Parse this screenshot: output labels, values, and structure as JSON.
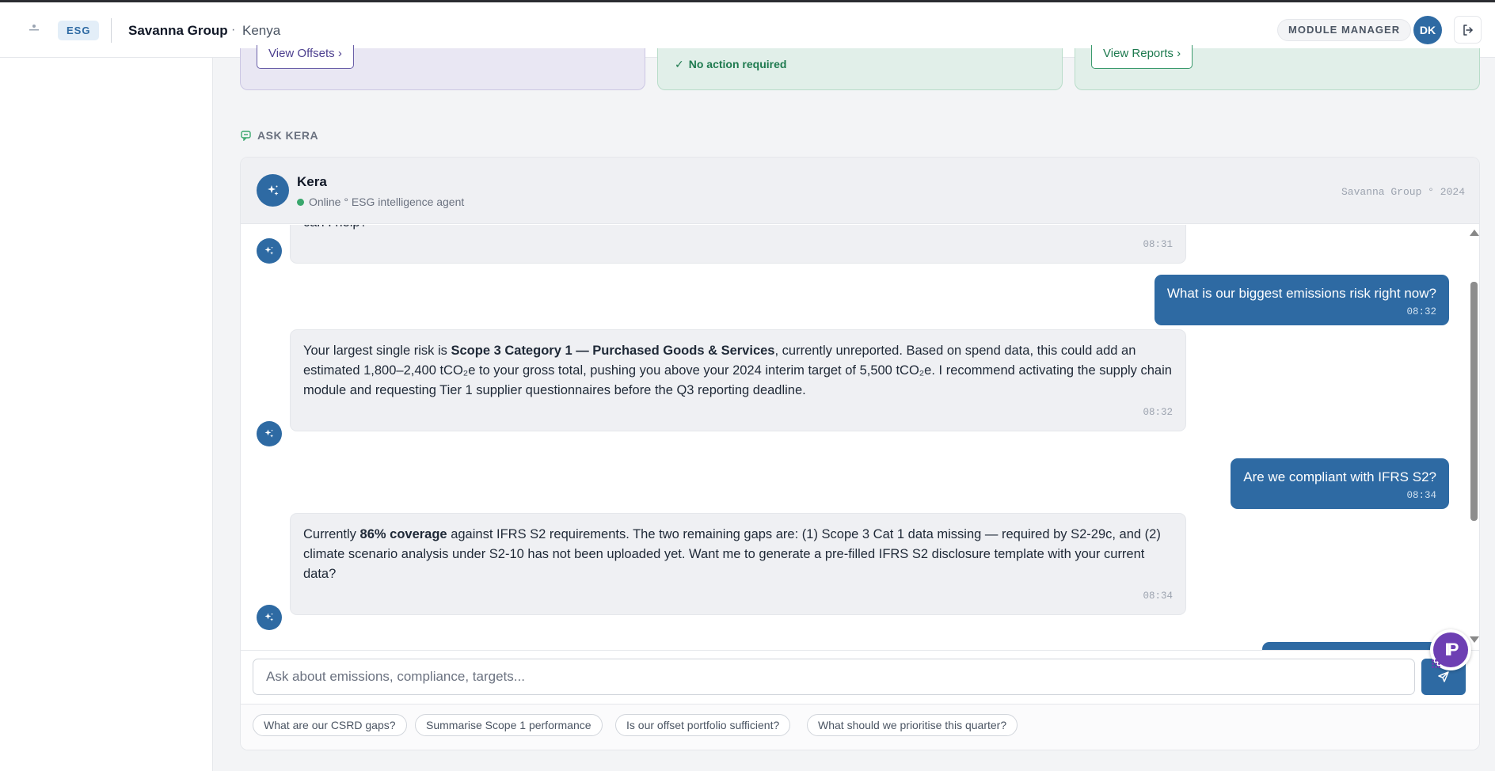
{
  "header": {
    "badge": "ESG",
    "org_name": "Savanna Group",
    "separator": "·",
    "country": "Kenya",
    "role": "MODULE MANAGER",
    "user_initials": "DK"
  },
  "cards": {
    "offsets_button": "View Offsets",
    "status_text": "No action required",
    "reports_button": "View Reports"
  },
  "section": {
    "title": "ASK KERA"
  },
  "chat": {
    "agent_name": "Kera",
    "agent_status": "Online ° ESG intelligence agent",
    "meta": "Savanna Group ° 2024",
    "messages": [
      {
        "from": "bot",
        "text": "can I help?",
        "time": "08:31"
      },
      {
        "from": "user",
        "text": "What is our biggest emissions risk right now?",
        "time": "08:32"
      },
      {
        "from": "bot",
        "pre": "Your largest single risk is ",
        "bold": "Scope 3 Category 1 — Purchased Goods & Services",
        "post": ", currently unreported. Based on spend data, this could add an estimated 1,800–2,400 tCO₂e to your gross total, pushing you above your 2024 interim target of 5,500 tCO₂e. I recommend activating the supply chain module and requesting Tier 1 supplier questionnaires before the Q3 reporting deadline.",
        "time": "08:32"
      },
      {
        "from": "user",
        "text": "Are we compliant with IFRS S2?",
        "time": "08:34"
      },
      {
        "from": "bot",
        "pre": "Currently ",
        "bold": "86% coverage",
        "post": " against IFRS S2 requirements. The two remaining gaps are: (1) Scope 3 Cat 1 data missing — required by S2-29c, and (2) climate scenario analysis under S2-10 has not been uploaded yet. Want me to generate a pre-filled IFRS S2 disclosure template with your current data?",
        "time": "08:34"
      }
    ],
    "input_placeholder": "Ask about emissions, compliance, targets...",
    "suggestions": [
      "What are our CSRD gaps?",
      "Summarise Scope 1 performance",
      "Is our offset portfolio sufficient?",
      "What should we prioritise this quarter?"
    ]
  },
  "widget": {
    "label": "IP"
  },
  "colors": {
    "primary": "#2e6aa3",
    "success": "#1e7a4f",
    "offsets": "#4c3f8f",
    "widget": "#6d3fb3"
  }
}
